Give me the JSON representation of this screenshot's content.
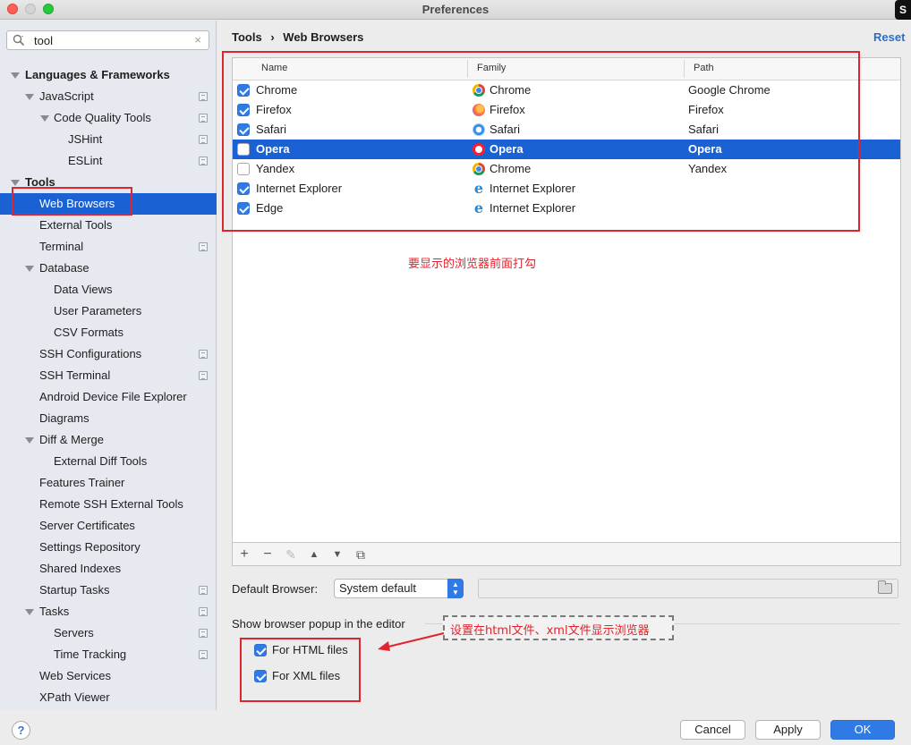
{
  "window": {
    "title": "Preferences",
    "badge": "S"
  },
  "search": {
    "value": "tool",
    "clear_glyph": "×"
  },
  "tree": [
    {
      "label": "Languages & Frameworks",
      "level": 0,
      "bold": true,
      "expanded": true
    },
    {
      "label": "JavaScript",
      "level": 1,
      "expanded": true,
      "project_icon": true
    },
    {
      "label": "Code Quality Tools",
      "level": 2,
      "expanded": true,
      "project_icon": true
    },
    {
      "label": "JSHint",
      "level": 3,
      "project_icon": true
    },
    {
      "label": "ESLint",
      "level": 3,
      "project_icon": true
    },
    {
      "label": "Tools",
      "level": 0,
      "bold": true,
      "expanded": true
    },
    {
      "label": "Web Browsers",
      "level": 1,
      "selected": true
    },
    {
      "label": "External Tools",
      "level": 1
    },
    {
      "label": "Terminal",
      "level": 1,
      "project_icon": true
    },
    {
      "label": "Database",
      "level": 1,
      "expanded": true
    },
    {
      "label": "Data Views",
      "level": 2
    },
    {
      "label": "User Parameters",
      "level": 2
    },
    {
      "label": "CSV Formats",
      "level": 2
    },
    {
      "label": "SSH Configurations",
      "level": 1,
      "project_icon": true
    },
    {
      "label": "SSH Terminal",
      "level": 1,
      "project_icon": true
    },
    {
      "label": "Android Device File Explorer",
      "level": 1
    },
    {
      "label": "Diagrams",
      "level": 1
    },
    {
      "label": "Diff & Merge",
      "level": 1,
      "expanded": true
    },
    {
      "label": "External Diff Tools",
      "level": 2
    },
    {
      "label": "Features Trainer",
      "level": 1
    },
    {
      "label": "Remote SSH External Tools",
      "level": 1
    },
    {
      "label": "Server Certificates",
      "level": 1
    },
    {
      "label": "Settings Repository",
      "level": 1
    },
    {
      "label": "Shared Indexes",
      "level": 1
    },
    {
      "label": "Startup Tasks",
      "level": 1,
      "project_icon": true
    },
    {
      "label": "Tasks",
      "level": 1,
      "expanded": true,
      "project_icon": true
    },
    {
      "label": "Servers",
      "level": 2,
      "project_icon": true
    },
    {
      "label": "Time Tracking",
      "level": 2,
      "project_icon": true
    },
    {
      "label": "Web Services",
      "level": 1
    },
    {
      "label": "XPath Viewer",
      "level": 1
    }
  ],
  "breadcrumb": {
    "parent": "Tools",
    "separator": "›",
    "current": "Web Browsers"
  },
  "reset_label": "Reset",
  "browsers_table": {
    "columns": [
      "Name",
      "Family",
      "Path"
    ],
    "rows": [
      {
        "checked": true,
        "name": "Chrome",
        "family": "Chrome",
        "family_icon": "chrome-icon",
        "path": "Google Chrome"
      },
      {
        "checked": true,
        "name": "Firefox",
        "family": "Firefox",
        "family_icon": "firefox-icon",
        "path": "Firefox"
      },
      {
        "checked": true,
        "name": "Safari",
        "family": "Safari",
        "family_icon": "safari-icon",
        "path": "Safari"
      },
      {
        "checked": false,
        "name": "Opera",
        "family": "Opera",
        "family_icon": "opera-icon",
        "path": "Opera",
        "selected": true
      },
      {
        "checked": false,
        "name": "Yandex",
        "family": "Chrome",
        "family_icon": "chrome-icon",
        "path": "Yandex"
      },
      {
        "checked": true,
        "name": "Internet Explorer",
        "family": "Internet Explorer",
        "family_icon": "ie-icon",
        "path": ""
      },
      {
        "checked": true,
        "name": "Edge",
        "family": "Internet Explorer",
        "family_icon": "ie-icon",
        "path": ""
      }
    ]
  },
  "table_toolbar": {
    "add": "+",
    "remove": "−",
    "edit": "✎",
    "up": "▲",
    "down": "▼",
    "copy": "⧉"
  },
  "default_browser": {
    "label": "Default Browser:",
    "value": "System default",
    "arrows": "▲\n▼"
  },
  "popup_section": {
    "label": "Show browser popup in the editor",
    "options": [
      {
        "label": "For HTML files",
        "checked": true
      },
      {
        "label": "For XML files",
        "checked": true
      }
    ]
  },
  "annotations": {
    "table_note": "要显示的浏览器前面打勾",
    "popup_note": "设置在html文件、xml文件显示浏览器",
    "color": "#e0242e"
  },
  "buttons": {
    "help": "?",
    "cancel": "Cancel",
    "apply": "Apply",
    "ok": "OK"
  },
  "colors": {
    "selection": "#1a62d3",
    "accent": "#2f7ae5",
    "link": "#2a6ecb"
  }
}
